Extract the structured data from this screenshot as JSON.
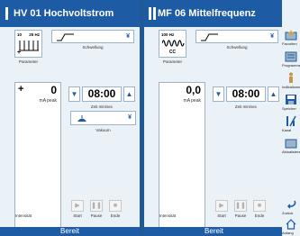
{
  "channels": [
    {
      "title": "HV 01  Hochvoltstrom",
      "param": {
        "low": "10",
        "high": "25 Hz",
        "mid": "",
        "caption": "Parameter"
      },
      "swell_caption": "Schwellung",
      "intensity": {
        "sign": "+",
        "value": "0",
        "unit": "mA peak",
        "caption": "Intensität"
      },
      "timer": {
        "value": "08:00",
        "caption": "Zeit min/sec"
      },
      "vacuum_caption": "Vakuum",
      "controls": {
        "start": "Start",
        "pause": "Pause",
        "end": "Ende"
      },
      "status": "Bereit"
    },
    {
      "title": "MF 06  Mittelfrequenz",
      "param": {
        "low": "100 Hz",
        "high": "",
        "mid": "CC",
        "caption": "Parameter"
      },
      "swell_caption": "Schwellung",
      "intensity": {
        "sign": "",
        "value": "0,0",
        "unit": "mA peak",
        "caption": "Intensität"
      },
      "timer": {
        "value": "08:00",
        "caption": "Zeit min/sec"
      },
      "vacuum_caption": "",
      "controls": {
        "start": "Start",
        "pause": "Pause",
        "end": "Ende"
      },
      "status": "Bereit"
    }
  ],
  "sidebar": [
    {
      "label": "Favoriten",
      "icon": "star-folder-icon"
    },
    {
      "label": "Programme",
      "icon": "programs-icon"
    },
    {
      "label": "Indikationen",
      "icon": "body-figure-icon"
    },
    {
      "label": "Speicher",
      "icon": "save-icon"
    },
    {
      "label": "Kanal",
      "icon": "channel-icon"
    },
    {
      "label": "Aktualisieren",
      "icon": "refresh-icon"
    },
    {
      "label": "Zurück",
      "icon": "back-arrow-icon"
    },
    {
      "label": "Anfang",
      "icon": "home-icon"
    }
  ],
  "colors": {
    "accent": "#1e5ba5",
    "background": "#1f5a96",
    "panel": "#eaf1f7"
  }
}
